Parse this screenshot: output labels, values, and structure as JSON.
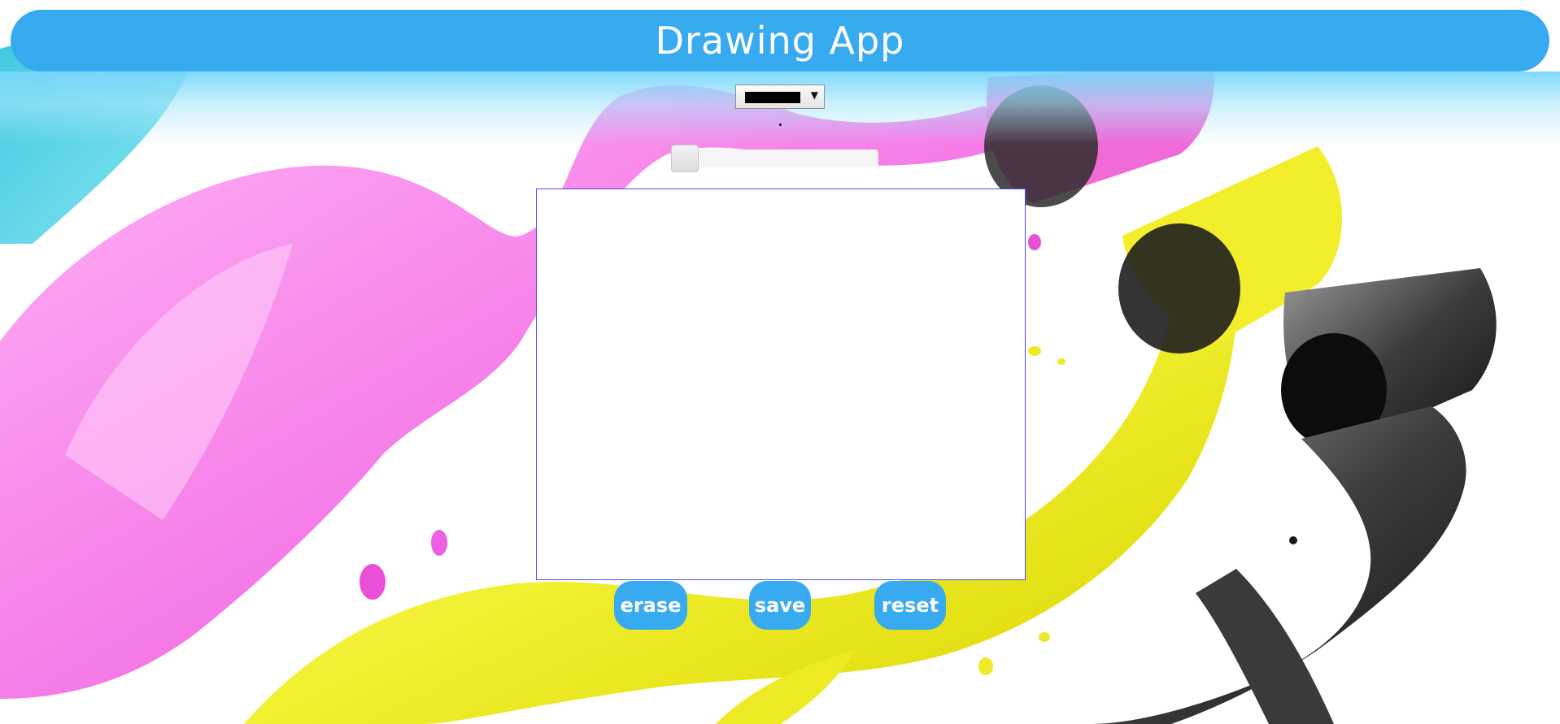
{
  "app": {
    "title": "Drawing App"
  },
  "controls": {
    "color_picker": {
      "selected_color": "#000000"
    },
    "brush_size": {
      "value_fraction": 0.0
    }
  },
  "buttons": {
    "erase_label": "erase",
    "save_label": "save",
    "reset_label": "reset"
  },
  "colors": {
    "accent": "#38aaf0",
    "canvas_border": "#4a4aff"
  },
  "icons": {
    "dropdown": "chevron-down-icon"
  }
}
